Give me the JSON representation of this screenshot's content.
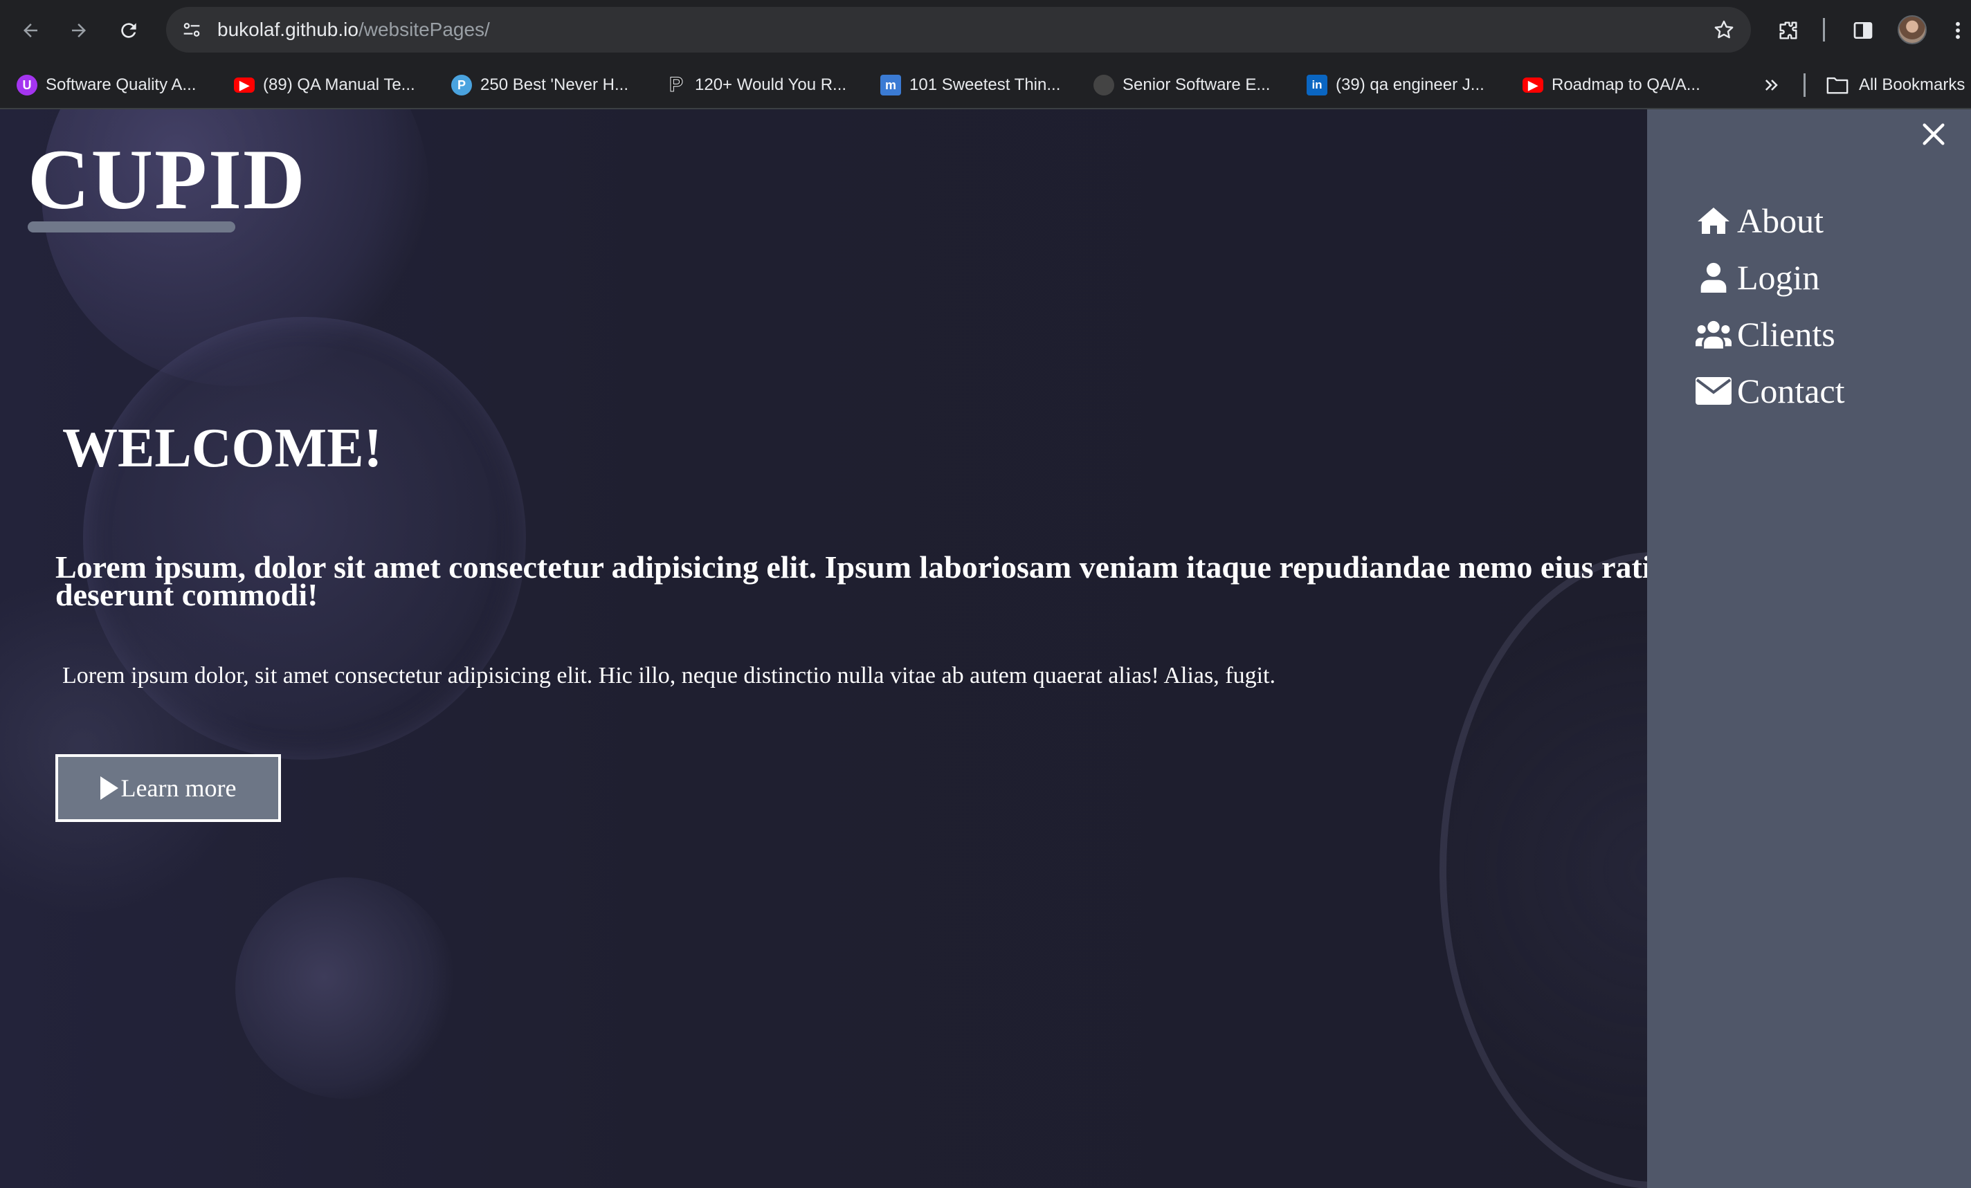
{
  "browser": {
    "url_host": "bukolaf.github.io",
    "url_path": "/websitePages/",
    "bookmarks": [
      {
        "label": "Software Quality A...",
        "icon": "udemy-icon",
        "color": "#a435f0"
      },
      {
        "label": "(89) QA Manual Te...",
        "icon": "youtube-icon",
        "color": "#ff0000"
      },
      {
        "label": "250 Best 'Never H...",
        "icon": "p-circle-icon",
        "color": "#4aa3df"
      },
      {
        "label": "120+ Would You R...",
        "icon": "p-letter-icon",
        "color": "#000000"
      },
      {
        "label": "101 Sweetest Thin...",
        "icon": "m-square-icon",
        "color": "#3b7bd4"
      },
      {
        "label": "Senior Software E...",
        "icon": "dark-circle-icon",
        "color": "#444444"
      },
      {
        "label": "(39) qa engineer J...",
        "icon": "linkedin-icon",
        "color": "#0a66c2"
      },
      {
        "label": "Roadmap to QA/A...",
        "icon": "youtube-icon",
        "color": "#ff0000"
      }
    ],
    "all_bookmarks_label": "All Bookmarks"
  },
  "site": {
    "logo": "CUPID",
    "welcome": "WELCOME!",
    "subheading": "Lorem ipsum, dolor sit amet consectetur adipisicing elit. Ipsum laboriosam veniam itaque repudiandae nemo eius ratione deserunt commodi!",
    "lead": "Lorem ipsum dolor, sit amet consectetur adipisicing elit. Hic illo, neque distinctio nulla vitae ab autem quaerat alias! Alias, fugit.",
    "learn_more": "Learn more",
    "menu": [
      {
        "label": "About",
        "icon": "home-icon"
      },
      {
        "label": "Login",
        "icon": "user-icon"
      },
      {
        "label": "Clients",
        "icon": "users-icon"
      },
      {
        "label": "Contact",
        "icon": "envelope-icon"
      }
    ]
  },
  "colors": {
    "browser_bg": "#202124",
    "page_bg": "#1f1f2e",
    "side_panel": "#505769",
    "button_bg": "#6d7686",
    "logo_underline": "#70788a"
  }
}
